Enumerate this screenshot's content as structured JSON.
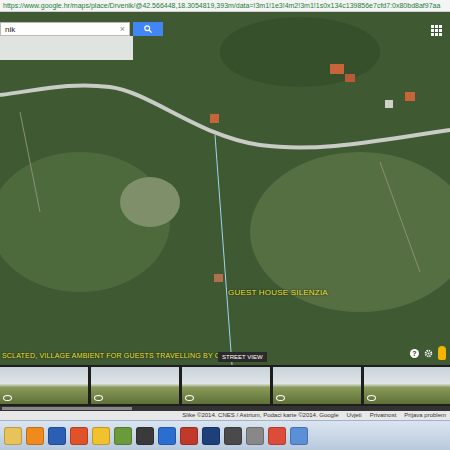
{
  "browser": {
    "url": "https://www.google.hr/maps/place/Drvenik/@42.566448,18.3054819,393m/data=!3m1!1e3!4m2!3m1!1s0x134c139856e7cfd7:0x80bd8af97aa"
  },
  "search": {
    "value": "nik",
    "clear": "×"
  },
  "map": {
    "place_label": "GUEST HOUSE SILENZIA",
    "caption": "SCLATED, VILLAGE AMBIENT FOR GUESTS TRAVELLING BY CAR",
    "help": "?"
  },
  "street_view": {
    "label": "STREET VIEW",
    "photos": [
      {
        "kind": "photo"
      },
      {
        "kind": "photo"
      },
      {
        "kind": "photo"
      },
      {
        "kind": "photo"
      },
      {
        "kind": "photo"
      }
    ]
  },
  "footer": [
    "Slike ©2014. CNES / Astrium, Podaci karte ©2014. Google",
    "Uvjeti",
    "Privatnost",
    "Prijava problem"
  ],
  "taskbar": {
    "apps": [
      {
        "color": "#e8c35a"
      },
      {
        "color": "#f08a1c"
      },
      {
        "color": "#2b5fb4"
      },
      {
        "color": "#e0522a"
      },
      {
        "color": "#f2c12e"
      },
      {
        "color": "#6a9a3a"
      },
      {
        "color": "#3a3a3a"
      },
      {
        "color": "#2a6fd0"
      },
      {
        "color": "#c0392b"
      },
      {
        "color": "#1d3f7a"
      },
      {
        "color": "#4a4a4a"
      },
      {
        "color": "#888888"
      },
      {
        "color": "#dd4b39"
      },
      {
        "color": "#5b8fd6"
      }
    ]
  }
}
